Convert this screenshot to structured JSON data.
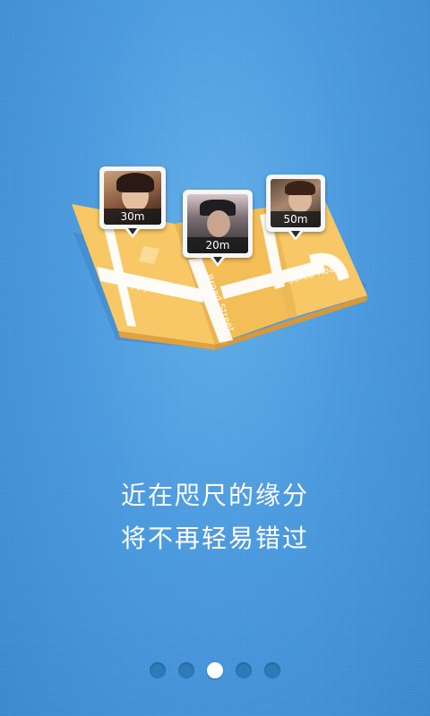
{
  "map": {
    "roads": [
      "Happy Road",
      "Broad Street",
      "Sorco Road"
    ]
  },
  "pins": [
    {
      "distance": "30m",
      "photo_icon": "user-photo-woman-glasses"
    },
    {
      "distance": "20m",
      "photo_icon": "user-photo-man-cap"
    },
    {
      "distance": "50m",
      "photo_icon": "user-photo-woman-glasses-2"
    }
  ],
  "slogan": {
    "line1": "近在咫尺的缘分",
    "line2": "将不再轻易错过"
  },
  "pagination": {
    "total": 5,
    "current": 3
  },
  "colors": {
    "background": "#4a9ade",
    "map_paper": "#f6c866",
    "road": "#ffffff",
    "dot_inactive": "#2f7ab8",
    "dot_active": "#ffffff"
  }
}
